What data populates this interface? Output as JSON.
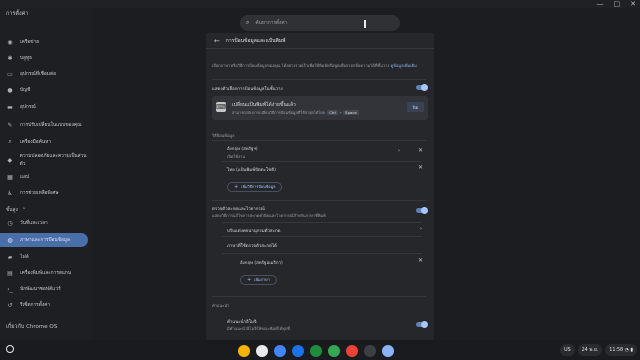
{
  "window": {
    "minimize": "—",
    "maximize": "□",
    "close": "✕"
  },
  "sidebar": {
    "title": "การตั้งค่า",
    "items": [
      {
        "label": "เครือข่าย",
        "icon": "wifi-icon"
      },
      {
        "label": "บลูทูธ",
        "icon": "bluetooth-icon"
      },
      {
        "label": "อุปกรณ์ที่เชื่อมต่อ",
        "icon": "connected-devices-icon"
      },
      {
        "label": "บัญชี",
        "icon": "accounts-icon"
      },
      {
        "label": "อุปกรณ์",
        "icon": "device-icon"
      },
      {
        "label": "การปรับเปลี่ยนในแบบของคุณ",
        "icon": "personalization-icon"
      },
      {
        "label": "เครื่องมือค้นหา",
        "icon": "search-engine-icon"
      },
      {
        "label": "ความปลอดภัยและความเป็นส่วนตัว",
        "icon": "security-icon"
      },
      {
        "label": "แอป",
        "icon": "apps-icon"
      },
      {
        "label": "การช่วยเหลือพิเศษ",
        "icon": "accessibility-icon"
      }
    ],
    "advanced_label": "ขั้นสูง",
    "advanced_items": [
      {
        "label": "วันที่และเวลา",
        "icon": "clock-icon"
      },
      {
        "label": "ภาษาและการป้อนข้อมูล",
        "icon": "globe-icon",
        "active": true
      },
      {
        "label": "ไฟล์",
        "icon": "folder-icon"
      },
      {
        "label": "เครื่องพิมพ์และการสแกน",
        "icon": "printer-icon"
      },
      {
        "label": "นักพัฒนาซอฟต์แวร์",
        "icon": "code-icon"
      },
      {
        "label": "รีเซ็ตการตั้งค่า",
        "icon": "reset-icon"
      }
    ],
    "about": "เกี่ยวกับ Chrome OS"
  },
  "search": {
    "placeholder": "ค้นหาการตั้งค่า"
  },
  "page": {
    "title": "การป้อนข้อมูลและแป้นพิมพ์",
    "intro": "เลือกภาษาหรือวิธีการป้อนข้อมูลของคุณ ได้อย่างรวดเร็วเพื่อใช้พิมพ์หรือพูดเพื่อกรอกข้อความได้ที่ชั้นวาง",
    "intro_link": "ดูข้อมูลเพิ่มเติม",
    "show_input_options": "แสดงตัวเลือกการป้อนข้อมูลในชั้นวาง",
    "kbd_title": "เปลี่ยนแป้นพิมพ์ได้ง่ายขึ้นแล้ว",
    "kbd_desc": "สามารถสลับการเปลี่ยนวิธีการป้อนข้อมูลที่ใช้ล่าสุดได้โดย",
    "kbd_key1": "Ctrl",
    "kbd_plus": "+",
    "kbd_key2": "Space",
    "kbd_close": "ปิด",
    "methods_heading": "วิธีป้อนข้อมูล",
    "method1_name": "อังกฤษ (สหรัฐฯ)",
    "method1_sub": "เปิดใช้งาน",
    "method2_name": "ไทย (แป้นพิมพ์ปัตตะโชติ)",
    "add_method": "เพิ่มวิธีการป้อนข้อมูล",
    "spell_title": "ตรวจตัวสะกดและไวยากรณ์",
    "spell_desc": "แสดงวิธีการแก้ไขการสะกดคำผิดและไวยากรณ์สำหรับภาษาที่พิมพ์",
    "spell_custom": "ปรับแต่งพจนานุกรมตัวสะกด",
    "spell_langs": "ภาษาที่ใช้ตรวจตัวสะกดได้",
    "spell_lang1": "อังกฤษ (สหรัฐอเมริกา)",
    "add_lang": "เพิ่มภาษา",
    "suggest_heading": "คำแนะนำ",
    "emoji_title": "คำแนะนำอิโมจิ",
    "emoji_desc": "มีคำแนะนำอิโมจิให้ขณะพิมพ์ได้ทุกที่"
  },
  "shelf": {
    "apps": [
      {
        "name": "chrome-icon",
        "color": "#f4b400"
      },
      {
        "name": "gmail-icon",
        "color": "#e8eaed"
      },
      {
        "name": "docs-icon",
        "color": "#4285f4"
      },
      {
        "name": "files-icon",
        "color": "#1a73e8"
      },
      {
        "name": "meet-icon",
        "color": "#1e8e3e"
      },
      {
        "name": "play-store-icon",
        "color": "#34a853"
      },
      {
        "name": "youtube-icon",
        "color": "#ea4335"
      },
      {
        "name": "terminal-icon",
        "color": "#3c4043"
      },
      {
        "name": "settings-icon",
        "color": "#8ab4f8"
      }
    ],
    "ime": "US",
    "date": "24 พ.ย.",
    "time": "11:58"
  }
}
